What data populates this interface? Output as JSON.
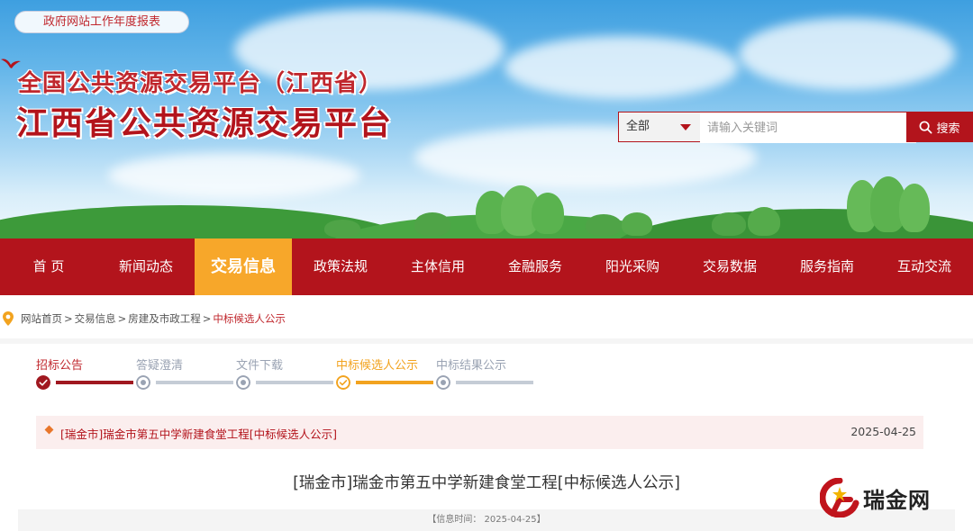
{
  "top_link": "政府网站工作年度报表",
  "header": {
    "subtitle": "全国公共资源交易平台（江西省）",
    "title": "江西省公共资源交易平台"
  },
  "search": {
    "scope": "全部",
    "placeholder": "请输入关键词",
    "button_label": "搜索"
  },
  "nav": {
    "items": [
      "首 页",
      "新闻动态",
      "交易信息",
      "政策法规",
      "主体信用",
      "金融服务",
      "阳光采购",
      "交易数据",
      "服务指南",
      "互动交流"
    ],
    "active_index": 2
  },
  "breadcrumb": {
    "items": [
      "网站首页",
      "交易信息",
      "房建及市政工程",
      "中标候选人公示"
    ],
    "separator": ">"
  },
  "steps": {
    "items": [
      "招标公告",
      "答疑澄清",
      "文件下载",
      "中标候选人公示",
      "中标结果公示"
    ],
    "completed_index": 0,
    "current_index": 3
  },
  "list_row": {
    "title": "[瑞金市]瑞金市第五中学新建食堂工程[中标候选人公示]",
    "date": "2025-04-25"
  },
  "article": {
    "title": "[瑞金市]瑞金市第五中学新建食堂工程[中标候选人公示]",
    "meta": "【信息时间： 2025-04-25】"
  },
  "watermark": {
    "text": "瑞金网"
  },
  "colors": {
    "brand_red": "#b3141c",
    "accent_orange": "#f7a72a",
    "inactive_gray": "#9aa3b3"
  }
}
